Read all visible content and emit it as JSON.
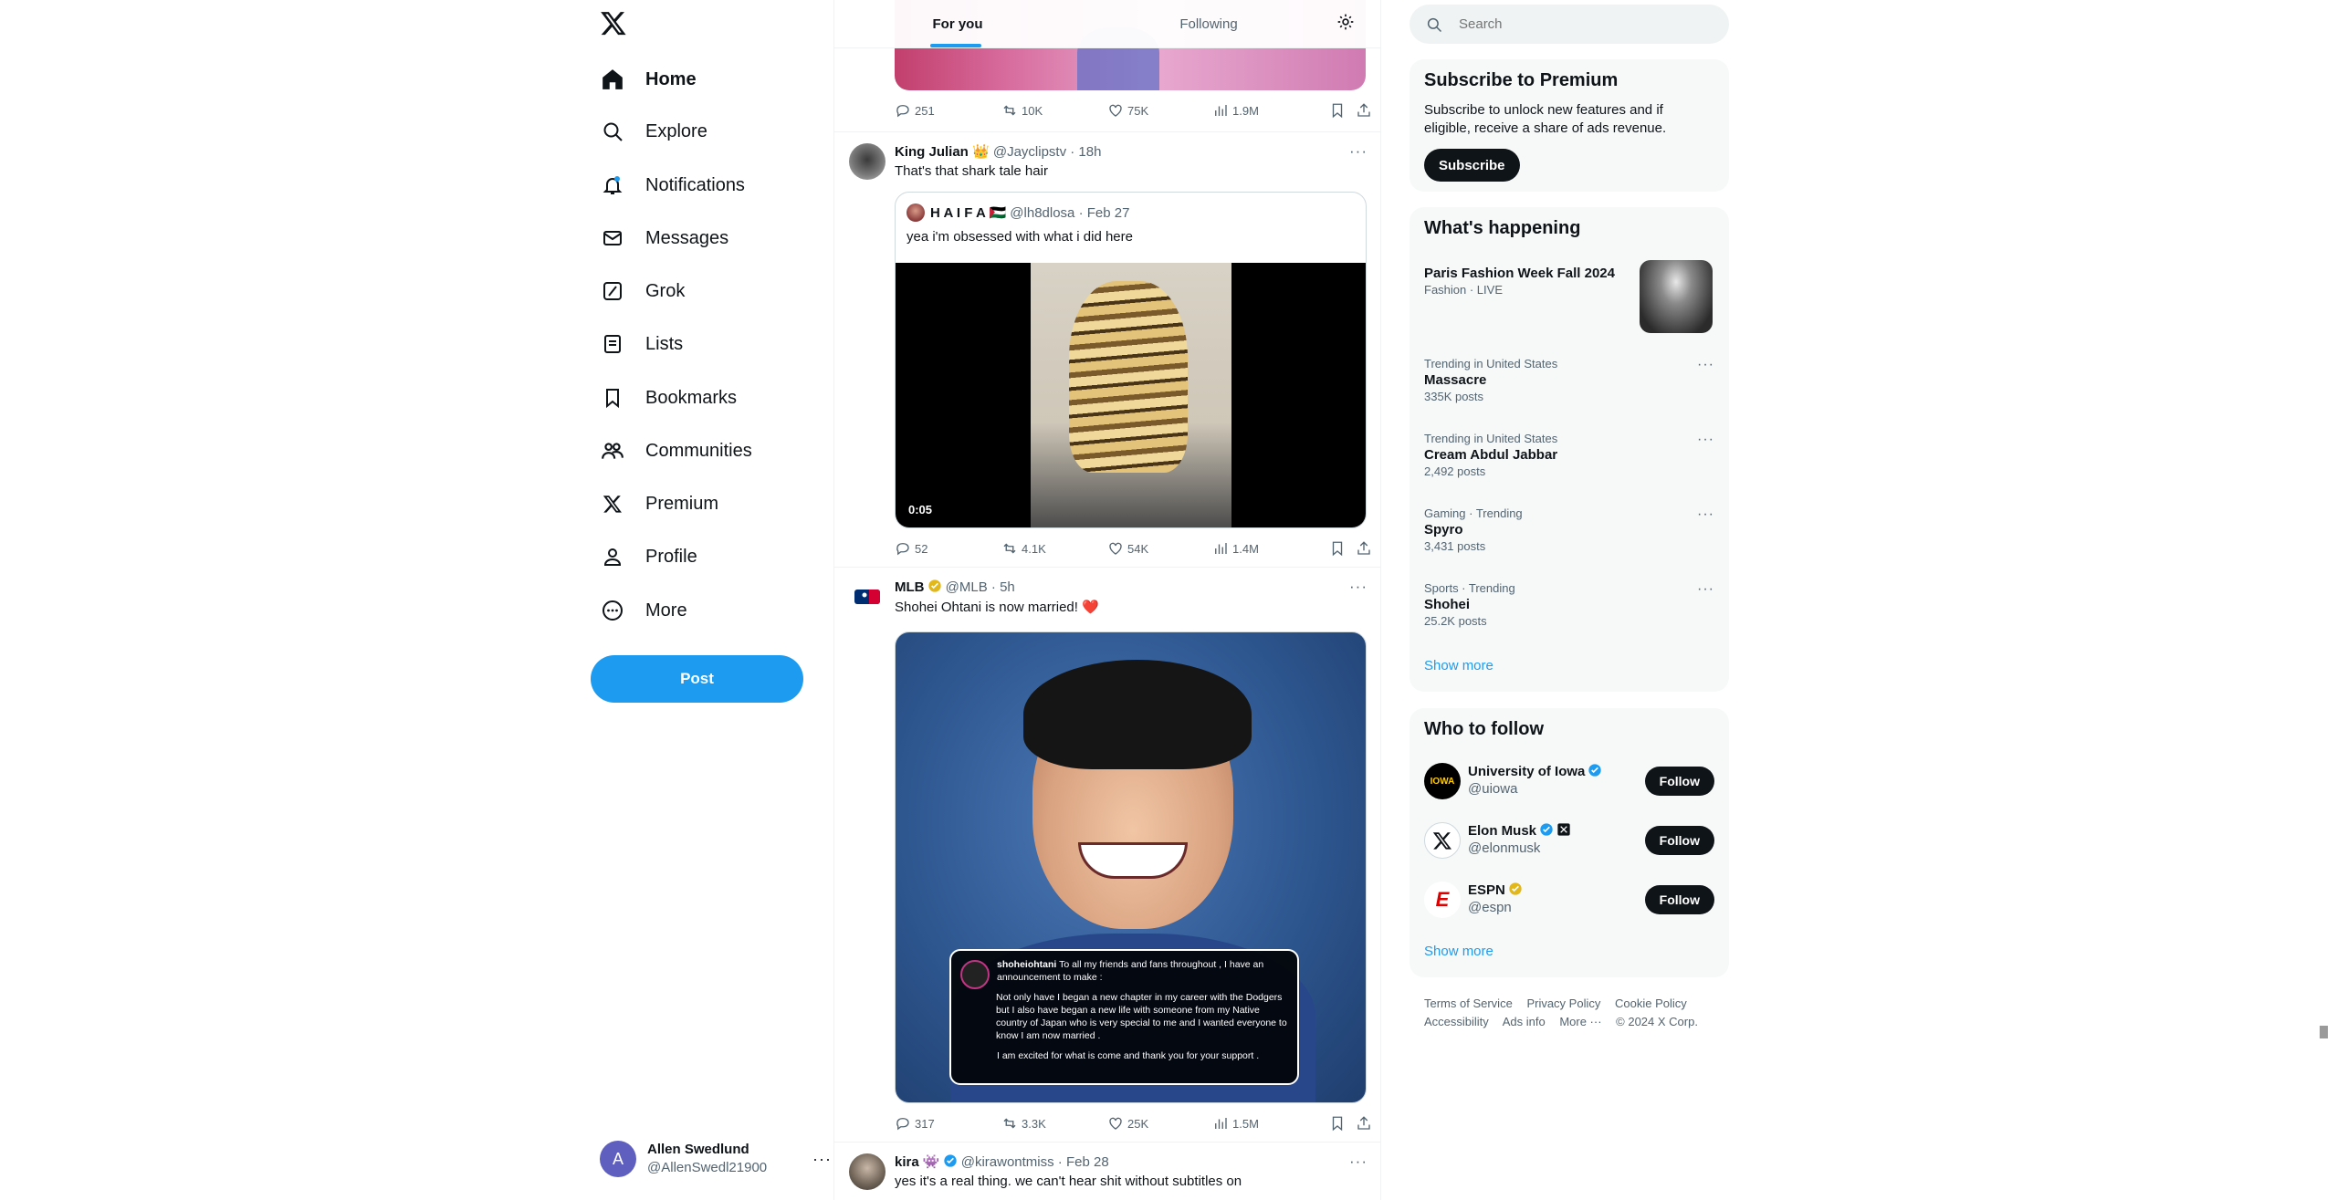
{
  "nav": {
    "items": [
      {
        "label": "Home",
        "icon": "home-icon",
        "active": true
      },
      {
        "label": "Explore",
        "icon": "search-icon"
      },
      {
        "label": "Notifications",
        "icon": "bell-icon"
      },
      {
        "label": "Messages",
        "icon": "envelope-icon"
      },
      {
        "label": "Grok",
        "icon": "grok-icon"
      },
      {
        "label": "Lists",
        "icon": "list-icon"
      },
      {
        "label": "Bookmarks",
        "icon": "bookmark-icon"
      },
      {
        "label": "Communities",
        "icon": "communities-icon"
      },
      {
        "label": "Premium",
        "icon": "x-logo-icon"
      },
      {
        "label": "Profile",
        "icon": "person-icon"
      },
      {
        "label": "More",
        "icon": "more-circle-icon"
      }
    ],
    "post_label": "Post"
  },
  "account": {
    "initial": "A",
    "name": "Allen Swedlund",
    "handle": "@AllenSwedl21900"
  },
  "tabs": {
    "for_you": "For you",
    "following": "Following"
  },
  "tweets": [
    {
      "actions": {
        "replies": "251",
        "reposts": "10K",
        "likes": "75K",
        "views": "1.9M"
      }
    },
    {
      "name": "King Julian 👑",
      "meta": "@Jayclipstv · 18h",
      "text": "That's that shark tale hair",
      "quote": {
        "name": "H A I F A 🇵🇸",
        "meta": "@lh8dlosa · Feb 27",
        "text": "yea i'm obsessed with what i did here",
        "duration": "0:05"
      },
      "actions": {
        "replies": "52",
        "reposts": "4.1K",
        "likes": "54K",
        "views": "1.4M"
      }
    },
    {
      "name": "MLB",
      "meta": "@MLB · 5h",
      "text": "Shohei Ohtani is now married! ❤️",
      "image_card": {
        "user": "shoheiohtani",
        "intro": "To all my friends and fans throughout , I have an announcement to make :",
        "body": "Not only have I began a new chapter in my career with the Dodgers but I also have began a new life with someone from my Native country of Japan who is very special to me and I wanted everyone to know I am now married .",
        "closing": "I am excited for what is come and thank you for your support ."
      },
      "actions": {
        "replies": "317",
        "reposts": "3.3K",
        "likes": "25K",
        "views": "1.5M"
      }
    },
    {
      "name": "kira 👾",
      "meta": "@kirawontmiss · Feb 28",
      "text": "yes it's a real thing. we can't hear shit without subtitles on"
    }
  ],
  "search": {
    "placeholder": "Search"
  },
  "premium": {
    "title": "Subscribe to Premium",
    "desc": "Subscribe to unlock new features and if eligible, receive a share of ads revenue.",
    "button": "Subscribe"
  },
  "happening": {
    "title": "What's happening",
    "featured": {
      "title": "Paris Fashion Week Fall 2024",
      "context": "Fashion · LIVE"
    },
    "trends": [
      {
        "context": "Trending in United States",
        "title": "Massacre",
        "count": "335K posts"
      },
      {
        "context": "Trending in United States",
        "title": "Cream Abdul Jabbar",
        "count": "2,492 posts"
      },
      {
        "context": "Gaming · Trending",
        "title": "Spyro",
        "count": "3,431 posts"
      },
      {
        "context": "Sports · Trending",
        "title": "Shohei",
        "count": "25.2K posts"
      }
    ],
    "show_more": "Show more"
  },
  "who_to_follow": {
    "title": "Who to follow",
    "accounts": [
      {
        "name": "University of Iowa",
        "handle": "@uiowa",
        "button": "Follow"
      },
      {
        "name": "Elon Musk",
        "handle": "@elonmusk",
        "button": "Follow"
      },
      {
        "name": "ESPN",
        "handle": "@espn",
        "button": "Follow"
      }
    ],
    "show_more": "Show more"
  },
  "footer": {
    "links": [
      "Terms of Service",
      "Privacy Policy",
      "Cookie Policy",
      "Accessibility",
      "Ads info",
      "More ···",
      "© 2024 X Corp."
    ]
  },
  "colors": {
    "accent": "#1d9bf0",
    "text": "#0f1419",
    "muted": "#536471",
    "gold_badge": "#e2b719"
  }
}
